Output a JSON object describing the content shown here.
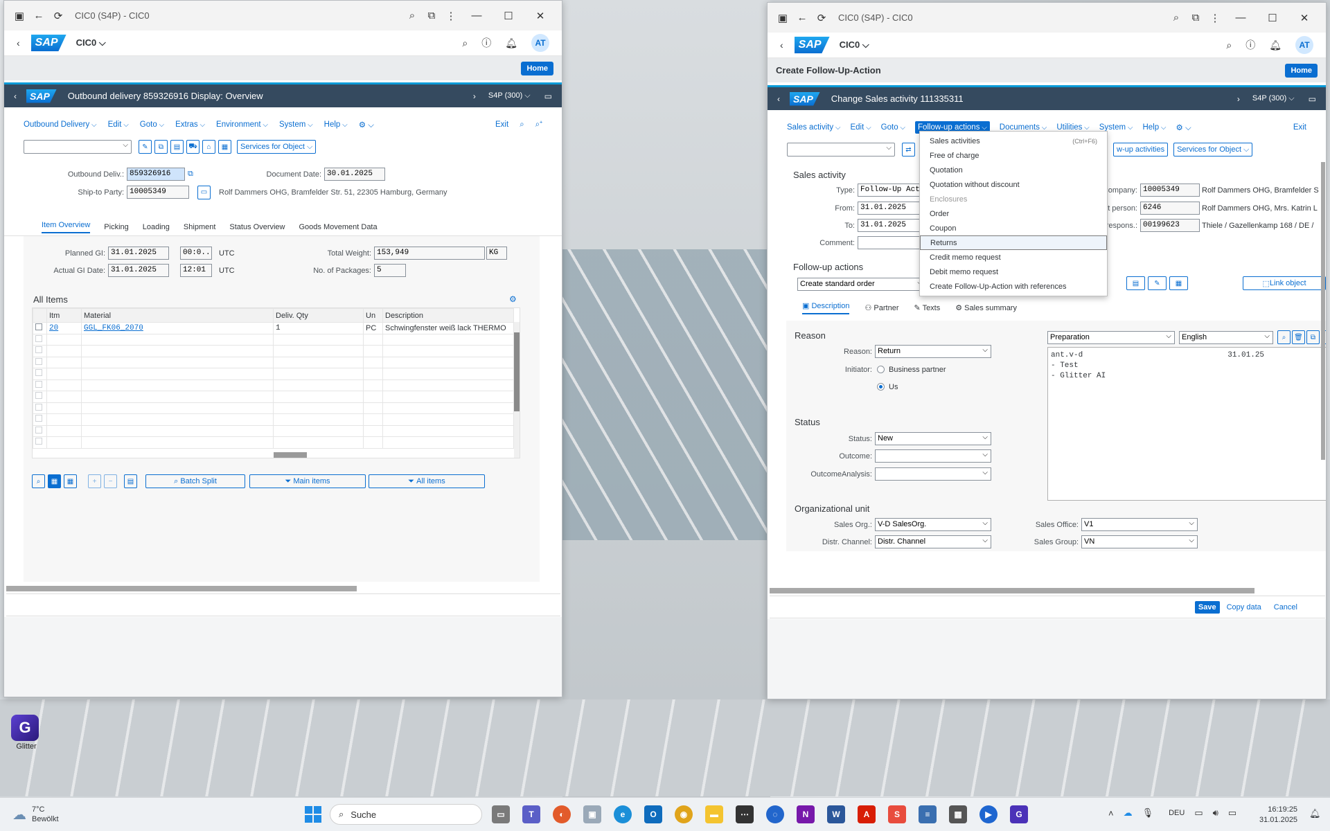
{
  "left_window": {
    "title": "CIC0 (S4P) - CIC0",
    "shell": {
      "app": "CIC0",
      "avatar": "AT",
      "home": "Home"
    },
    "header": {
      "title": "Outbound delivery 859326916 Display: Overview",
      "system": "S4P (300)"
    },
    "menu": [
      "Outbound Delivery",
      "Edit",
      "Goto",
      "Extras",
      "Environment",
      "System",
      "Help"
    ],
    "exit_label": "Exit",
    "services_label": "Services for Object",
    "fields": {
      "outbound_deliv_label": "Outbound Deliv.:",
      "outbound_deliv_value": "859326916",
      "document_date_label": "Document Date:",
      "document_date_value": "30.01.2025",
      "ship_to_label": "Ship-to Party:",
      "ship_to_value": "10005349",
      "ship_to_text": "Rolf Dammers OHG, Bramfelder Str. 51, 22305 Hamburg, Germany"
    },
    "tabs": [
      "Item Overview",
      "Picking",
      "Loading",
      "Shipment",
      "Status Overview",
      "Goods Movement Data"
    ],
    "overview": {
      "planned_gi_label": "Planned GI:",
      "planned_gi_date": "31.01.2025",
      "planned_gi_time": "00:0...",
      "planned_tz": "UTC",
      "actual_gi_label": "Actual GI Date:",
      "actual_gi_date": "31.01.2025",
      "actual_gi_time": "12:01",
      "actual_tz": "UTC",
      "total_weight_label": "Total Weight:",
      "total_weight_value": "153,949",
      "weight_unit": "KG",
      "packages_label": "No. of Packages:",
      "packages_value": "5"
    },
    "all_items_title": "All Items",
    "table": {
      "headers": [
        "Itm",
        "Material",
        "Deliv. Qty",
        "Un",
        "Description"
      ],
      "row": {
        "itm": "20",
        "material": "GGL_FK06_2070",
        "qty": "1",
        "un": "PC",
        "description": "Schwingfenster weiß lack THERMO"
      }
    },
    "footer_buttons": {
      "batch_split": "Batch Split",
      "main_items": "Main items",
      "all_items": "All items"
    }
  },
  "right_window": {
    "title": "CIC0 (S4P) - CIC0",
    "shell": {
      "app": "CIC0",
      "avatar": "AT",
      "home": "Home"
    },
    "subtitle": "Create Follow-Up-Action",
    "header": {
      "title": "Change Sales activity 111335311",
      "system": "S4P (300)"
    },
    "menu": [
      "Sales activity",
      "Edit",
      "Goto",
      "Follow-up actions",
      "Documents",
      "Utilities",
      "System",
      "Help"
    ],
    "exit_label": "Exit",
    "toolbar_btn1": "w-up activities",
    "services_label": "Services for Object",
    "sales_activity_title": "Sales activity",
    "type_label": "Type:",
    "type_value": "Follow-Up Action",
    "from_label": "From:",
    "from_value": "31.01.2025",
    "to_label": "To:",
    "to_value": "31.01.2025",
    "comment_label": "Comment:",
    "company_label": "Company:",
    "company_value": "10005349",
    "company_text": "Rolf Dammers OHG, Bramfelder S",
    "contact_label": "ct person:",
    "contact_value": "6246",
    "contact_text": "Rolf Dammers OHG, Mrs. Katrin L",
    "respons_label": "respons.:",
    "respons_value": "00199623",
    "respons_text": "Thiele / Gazellenkamp 168 / DE /",
    "followup_title": "Follow-up actions",
    "followup_select": "Create standard order",
    "link_object": "Link object",
    "tabs": [
      "Description",
      "Partner",
      "Texts",
      "Sales summary"
    ],
    "reason_title": "Reason",
    "reason_label": "Reason:",
    "reason_value": "Return",
    "initiator_label": "Initiator:",
    "initiator_opt1": "Business partner",
    "initiator_opt2": "Us",
    "status_title": "Status",
    "status_label": "Status:",
    "status_value": "New",
    "outcome_label": "Outcome:",
    "outcome_analysis_label": "OutcomeAnalysis:",
    "text_type": "Preparation",
    "text_lang": "English",
    "notes": {
      "line1": "ant.v-d",
      "date": "31.01.25",
      "line2": "- Test",
      "line3": "- Glitter AI"
    },
    "org_title": "Organizational unit",
    "sales_org_label": "Sales Org.:",
    "sales_org_value": "V-D SalesOrg.",
    "distr_label": "Distr. Channel:",
    "distr_value": "Distr. Channel",
    "sales_office_label": "Sales Office:",
    "sales_office_value": "V1",
    "sales_group_label": "Sales Group:",
    "sales_group_value": "VN",
    "footer": {
      "save": "Save",
      "copy": "Copy data",
      "cancel": "Cancel"
    },
    "dropdown": {
      "items": [
        {
          "label": "Sales activities",
          "shortcut": "(Ctrl+F6)"
        },
        {
          "label": "Free of charge"
        },
        {
          "label": "Quotation"
        },
        {
          "label": "Quotation without discount"
        },
        {
          "label": "Enclosures",
          "disabled": true
        },
        {
          "label": "Order"
        },
        {
          "label": "Coupon"
        },
        {
          "label": "Returns",
          "selected": true
        },
        {
          "label": "Credit memo request"
        },
        {
          "label": "Debit memo request"
        },
        {
          "label": "Create Follow-Up-Action with references"
        }
      ]
    }
  },
  "desktop": {
    "glitter_label": "Glitter"
  },
  "taskbar": {
    "weather_temp": "7°C",
    "weather_text": "Bewölkt",
    "search_placeholder": "Suche",
    "lang": "DEU",
    "time": "16:19:25",
    "date": "31.01.2025"
  }
}
